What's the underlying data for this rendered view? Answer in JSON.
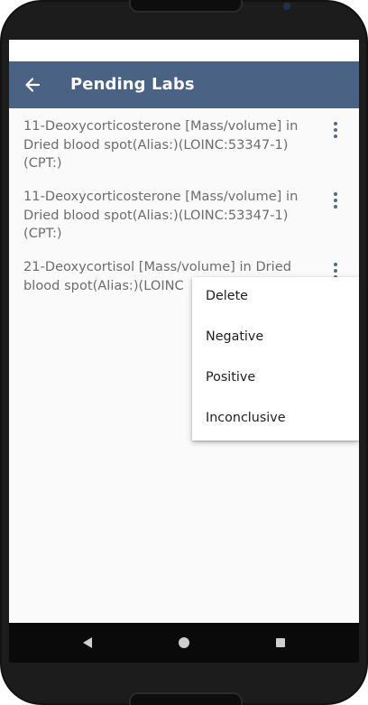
{
  "app_bar": {
    "title": "Pending Labs",
    "back_icon": "arrow-left-icon",
    "color": "#4a6283"
  },
  "labs": [
    {
      "line1": "11-Deoxycorticosterone [Mass/volume] in",
      "line2": "Dried blood spot(Alias:)(LOINC:53347-1)",
      "line3": "(CPT:)",
      "menu_icon": "more-vert-icon"
    },
    {
      "line1": "11-Deoxycorticosterone [Mass/volume] in",
      "line2": "Dried blood spot(Alias:)(LOINC:53347-1)",
      "line3": "(CPT:)",
      "menu_icon": "more-vert-icon"
    },
    {
      "line1": "21-Deoxycortisol [Mass/volume] in Dried",
      "line2": "blood spot(Alias:)(LOINC",
      "menu_icon": "more-vert-icon"
    }
  ],
  "popup_menu": {
    "items": [
      "Delete",
      "Negative",
      "Positive",
      "Inconclusive"
    ]
  },
  "nav_bar": {
    "back_icon": "nav-back-icon",
    "home_icon": "nav-home-icon",
    "recents_icon": "nav-recents-icon"
  }
}
